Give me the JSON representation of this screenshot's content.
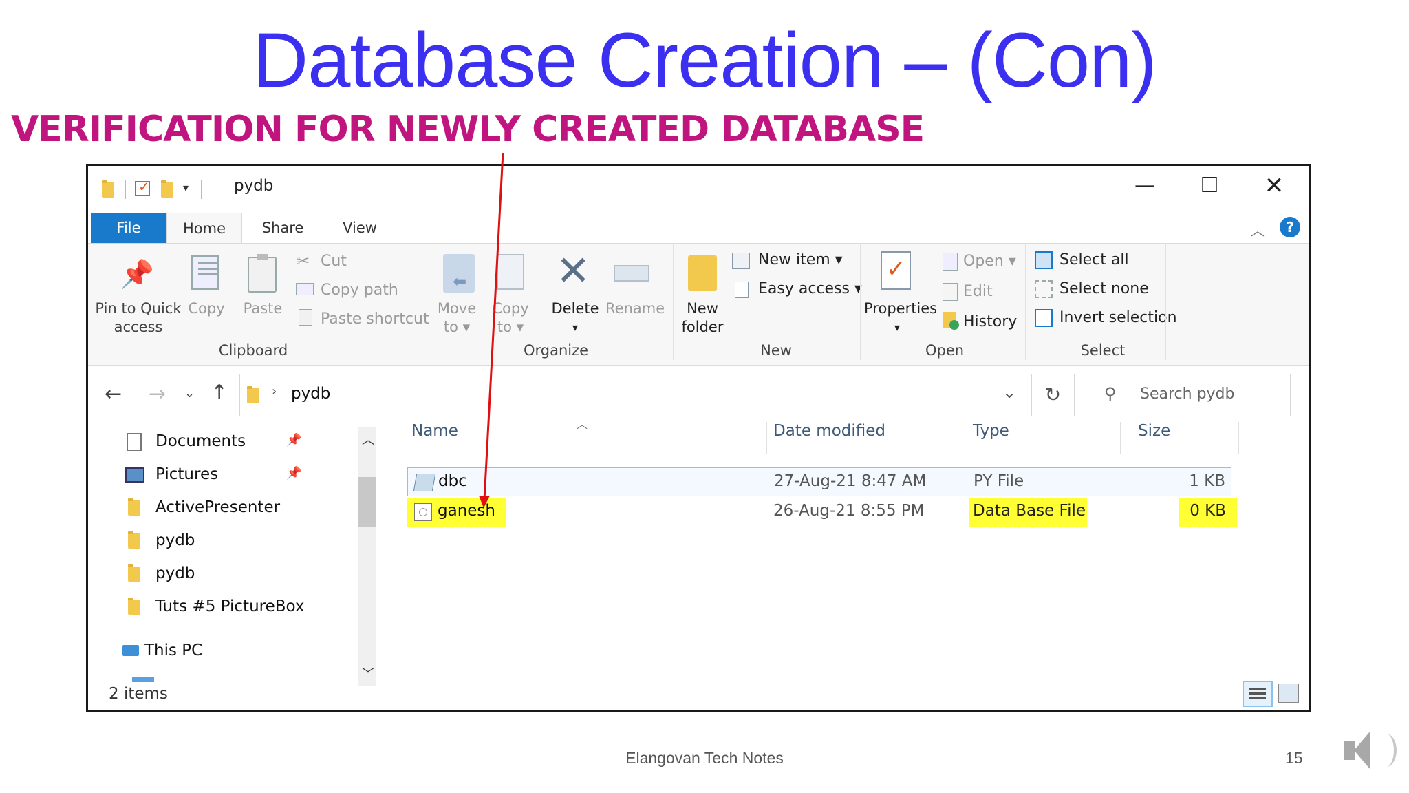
{
  "slide": {
    "title": "Database Creation – (Con)",
    "subtitle": "VERIFICATION FOR NEWLY CREATED DATABASE",
    "footer": "Elangovan Tech Notes",
    "page_number": "15",
    "title_color": "#3b2ff0",
    "subtitle_color": "#c0157f"
  },
  "window": {
    "title": "pydb",
    "tabs": [
      {
        "label": "File"
      },
      {
        "label": "Home"
      },
      {
        "label": "Share"
      },
      {
        "label": "View"
      }
    ],
    "ribbon": {
      "clipboard": {
        "group_label": "Clipboard",
        "pin_label_1": "Pin to Quick",
        "pin_label_2": "access",
        "copy": "Copy",
        "paste": "Paste",
        "cut": "Cut",
        "copy_path": "Copy path",
        "paste_shortcut": "Paste shortcut"
      },
      "organize": {
        "group_label": "Organize",
        "move_1": "Move",
        "move_2": "to",
        "copy_1": "Copy",
        "copy_2": "to",
        "delete": "Delete",
        "rename": "Rename"
      },
      "new": {
        "group_label": "New",
        "new_folder_1": "New",
        "new_folder_2": "folder",
        "new_item": "New item",
        "easy_access": "Easy access"
      },
      "open": {
        "group_label": "Open",
        "properties": "Properties",
        "open": "Open",
        "edit": "Edit",
        "history": "History"
      },
      "select": {
        "group_label": "Select",
        "select_all": "Select all",
        "select_none": "Select none",
        "invert_selection": "Invert selection"
      }
    },
    "address": {
      "path": "pydb",
      "search_placeholder": "Search pydb"
    },
    "nav_pane": {
      "items": [
        {
          "label": "Documents"
        },
        {
          "label": "Pictures"
        },
        {
          "label": "ActivePresenter"
        },
        {
          "label": "pydb"
        },
        {
          "label": "pydb"
        },
        {
          "label": "Tuts #5 PictureBox"
        },
        {
          "label": "This PC"
        }
      ]
    },
    "columns": {
      "name": "Name",
      "date": "Date modified",
      "type": "Type",
      "size": "Size"
    },
    "files": [
      {
        "name": "dbc",
        "date": "27-Aug-21 8:47 AM",
        "type": "PY File",
        "size": "1 KB"
      },
      {
        "name": "ganesh",
        "date": "26-Aug-21 8:55 PM",
        "type": "Data Base File",
        "size": "0 KB"
      }
    ],
    "status": "2 items",
    "highlight_color": "#ffff33",
    "accent_color": "#1979ca"
  }
}
